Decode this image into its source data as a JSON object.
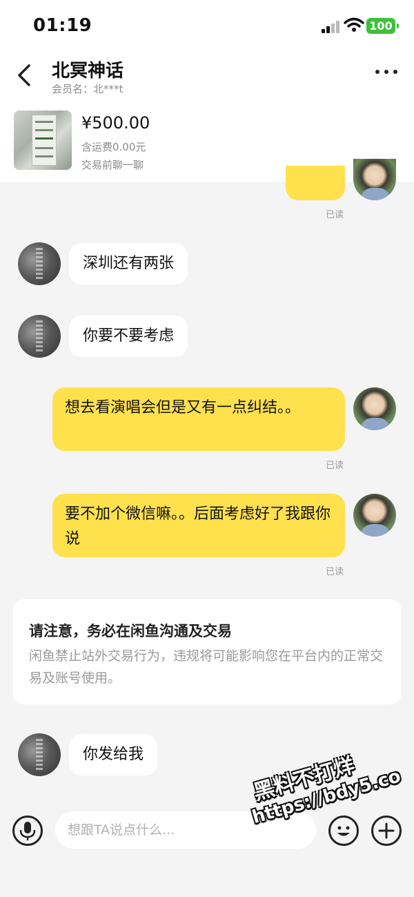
{
  "status_bar": {
    "time": "01:19",
    "battery": "100",
    "battery_color": "#3cc13b"
  },
  "header": {
    "title": "北冥神话",
    "member_label": "会员名：北***t",
    "back_icon": "chevron-left-icon",
    "more_icon": "more-dots-icon"
  },
  "product": {
    "price": "¥500.00",
    "shipping": "含运费0.00元",
    "tip": "交易前聊一聊"
  },
  "messages": [
    {
      "from": "me",
      "text": "",
      "read": "已读"
    },
    {
      "from": "other",
      "text": "深圳还有两张"
    },
    {
      "from": "other",
      "text": "你要不要考虑"
    },
    {
      "from": "me",
      "text": "想去看演唱会但是又有一点纠结。。",
      "read": "已读"
    },
    {
      "from": "me",
      "text": "要不加个微信嘛。。后面考虑好了我跟你说",
      "read": "已读"
    },
    {
      "from": "other",
      "text": "你发给我"
    }
  ],
  "notice": {
    "title": "请注意，务必在闲鱼沟通及交易",
    "body": "闲鱼禁止站外交易行为，违规将可能影响您在平台内的正常交易及账号使用。"
  },
  "input_bar": {
    "placeholder": "想跟TA说点什么...",
    "voice_icon": "microphone-icon",
    "emoji_icon": "smile-icon",
    "plus_icon": "plus-icon"
  },
  "watermark": {
    "line1": "黑料不打烊",
    "line2": "https://bdy5.co"
  },
  "colors": {
    "my_bubble": "#ffe14d",
    "other_bubble": "#ffffff",
    "background": "#f4f4f5"
  }
}
